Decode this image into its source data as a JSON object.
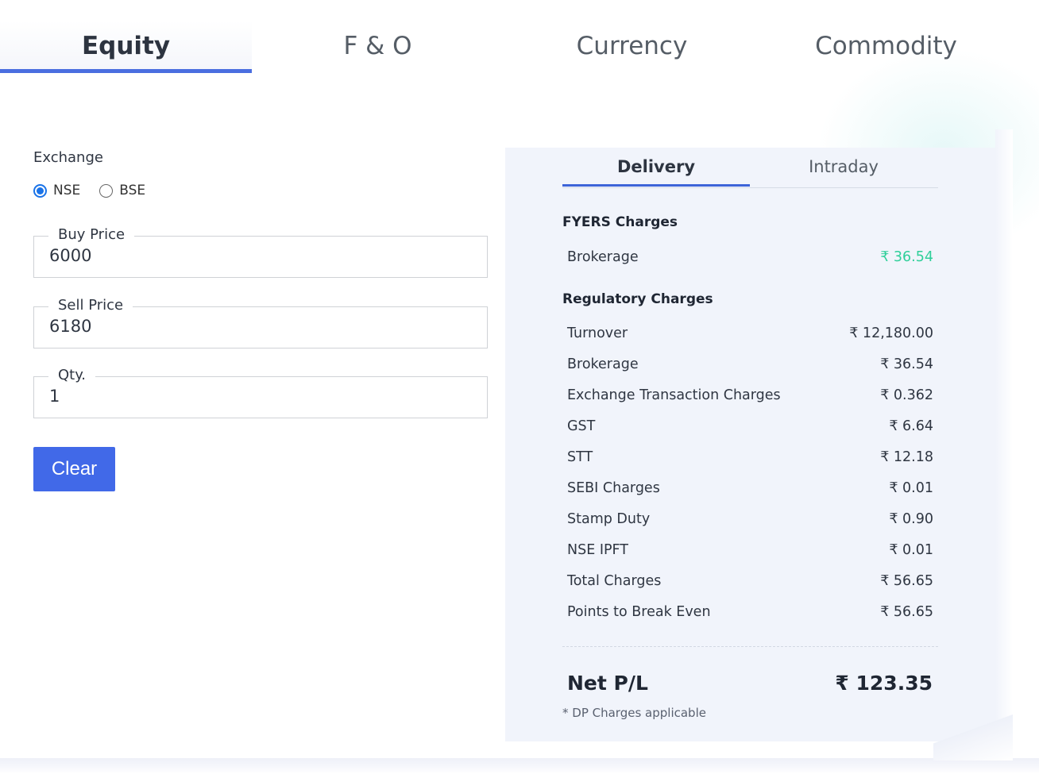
{
  "tabs": [
    {
      "label": "Equity",
      "active": true
    },
    {
      "label": "F & O",
      "active": false
    },
    {
      "label": "Currency",
      "active": false
    },
    {
      "label": "Commodity",
      "active": false
    }
  ],
  "form": {
    "exchange_label": "Exchange",
    "exchange_options": [
      {
        "label": "NSE",
        "checked": true
      },
      {
        "label": "BSE",
        "checked": false
      }
    ],
    "buy_price": {
      "label": "Buy Price",
      "value": "6000"
    },
    "sell_price": {
      "label": "Sell Price",
      "value": "6180"
    },
    "qty": {
      "label": "Qty.",
      "value": "1"
    },
    "clear_label": "Clear"
  },
  "panel": {
    "sub_tabs": [
      {
        "label": "Delivery",
        "active": true
      },
      {
        "label": "Intraday",
        "active": false
      }
    ],
    "fyers_title": "FYERS Charges",
    "fyers_rows": [
      {
        "label": "Brokerage",
        "value": "₹ 36.54"
      }
    ],
    "regulatory_title": "Regulatory Charges",
    "regulatory_rows": [
      {
        "label": "Turnover",
        "value": "₹ 12,180.00"
      },
      {
        "label": "Brokerage",
        "value": "₹ 36.54"
      },
      {
        "label": "Exchange Transaction Charges",
        "value": "₹ 0.362"
      },
      {
        "label": "GST",
        "value": "₹ 6.64"
      },
      {
        "label": "STT",
        "value": "₹ 12.18"
      },
      {
        "label": "SEBI Charges",
        "value": "₹ 0.01"
      },
      {
        "label": "Stamp Duty",
        "value": "₹ 0.90"
      },
      {
        "label": "NSE IPFT",
        "value": "₹ 0.01"
      },
      {
        "label": "Total Charges",
        "value": "₹ 56.65"
      },
      {
        "label": "Points to Break Even",
        "value": "₹ 56.65"
      }
    ],
    "net_label": "Net P/L",
    "net_value": "₹ 123.35",
    "note": "* DP Charges applicable"
  },
  "colors": {
    "accent": "#4169e8",
    "tab_underline": "#4a6ee0",
    "positive": "#2fcf9a",
    "panel_bg": "#f1f4fb"
  }
}
